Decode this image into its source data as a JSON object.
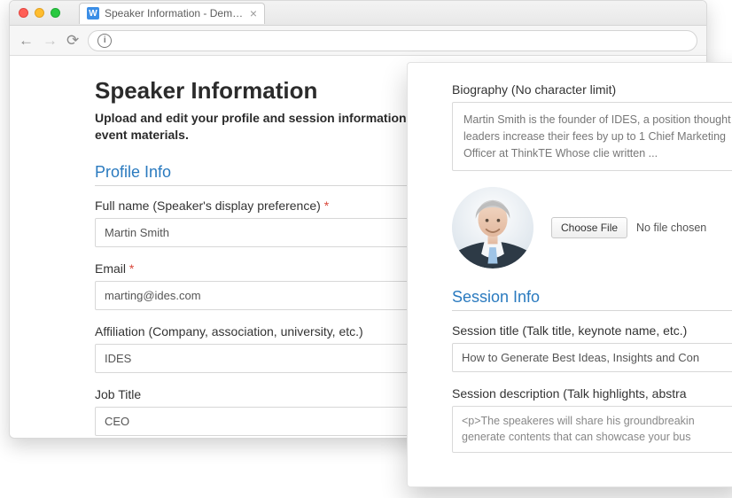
{
  "browser": {
    "tab_title": "Speaker Information - Demo E",
    "favicon_letter": "W"
  },
  "page": {
    "title": "Speaker Information",
    "subtitle": "Upload and edit your profile and session information for event materials.",
    "section_profile": "Profile Info",
    "full_name_label": "Full name (Speaker's display preference)",
    "full_name_value": "Martin Smith",
    "email_label": "Email",
    "email_value": "marting@ides.com",
    "affiliation_label": "Affiliation (Company, association, university, etc.)",
    "affiliation_value": "IDES",
    "job_title_label": "Job Title",
    "job_title_value": "CEO",
    "required_mark": "*"
  },
  "panel": {
    "bio_label": "Biography (No character limit)",
    "bio_text": "Martin Smith is the founder of IDES, a position thought leaders increase their fees by up to 1 Chief Marketing Officer at ThinkTE Whose clie written ...",
    "choose_file": "Choose File",
    "file_status": "No file chosen",
    "section_session": "Session Info",
    "session_title_label": "Session title (Talk title, keynote name, etc.)",
    "session_title_value": "How to Generate Best Ideas, Insights and Con",
    "session_desc_label": "Session description (Talk highlights, abstra",
    "session_desc_value": "<p>The speakeres will share his groundbreakin generate contents that can showcase your bus"
  }
}
